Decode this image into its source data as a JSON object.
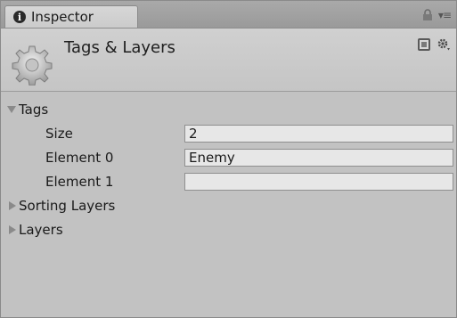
{
  "window": {
    "tab_title": "Inspector",
    "icons": [
      "info-icon",
      "lock-icon",
      "menu-icon"
    ]
  },
  "header": {
    "title": "Tags & Layers",
    "icons": [
      "settings-gear-icon",
      "help-book-icon",
      "gear-menu-icon"
    ]
  },
  "sections": {
    "tags": {
      "label": "Tags",
      "expanded": true,
      "size_label": "Size",
      "size_value": "2",
      "elements": [
        {
          "label": "Element 0",
          "value": "Enemy"
        },
        {
          "label": "Element 1",
          "value": ""
        }
      ]
    },
    "sorting_layers": {
      "label": "Sorting Layers",
      "expanded": false
    },
    "layers": {
      "label": "Layers",
      "expanded": false
    }
  },
  "colors": {
    "background": "#c2c2c2",
    "field_bg": "#e7e7e7",
    "field_border": "#8f8f8f"
  }
}
